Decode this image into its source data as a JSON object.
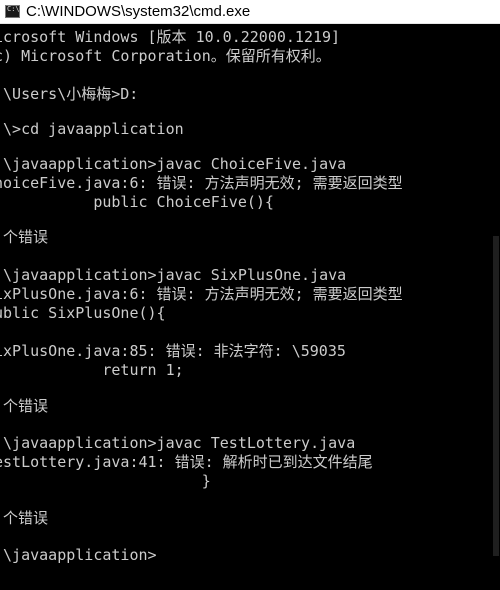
{
  "window": {
    "title": "C:\\WINDOWS\\system32\\cmd.exe"
  },
  "console": {
    "lines": [
      "icrosoft Windows [版本 10.0.22000.1219]",
      "c) Microsoft Corporation。保留所有权利。",
      "",
      ":\\Users\\小梅梅>D:",
      "",
      ":\\>cd javaapplication",
      "",
      ":\\javaapplication>javac ChoiceFive.java",
      "hoiceFive.java:6: 错误: 方法声明无效; 需要返回类型",
      "           public ChoiceFive(){",
      "",
      " 个错误",
      "",
      ":\\javaapplication>javac SixPlusOne.java",
      "ixPlusOne.java:6: 错误: 方法声明无效; 需要返回类型",
      "ublic SixPlusOne(){",
      "",
      "ixPlusOne.java:85: 错误: 非法字符: \\59035",
      "            return 1;",
      "",
      " 个错误",
      "",
      ":\\javaapplication>javac TestLottery.java",
      "estLottery.java:41: 错误: 解析时已到达文件结尾",
      "                       }",
      "",
      " 个错误",
      "",
      ":\\javaapplication>"
    ]
  }
}
